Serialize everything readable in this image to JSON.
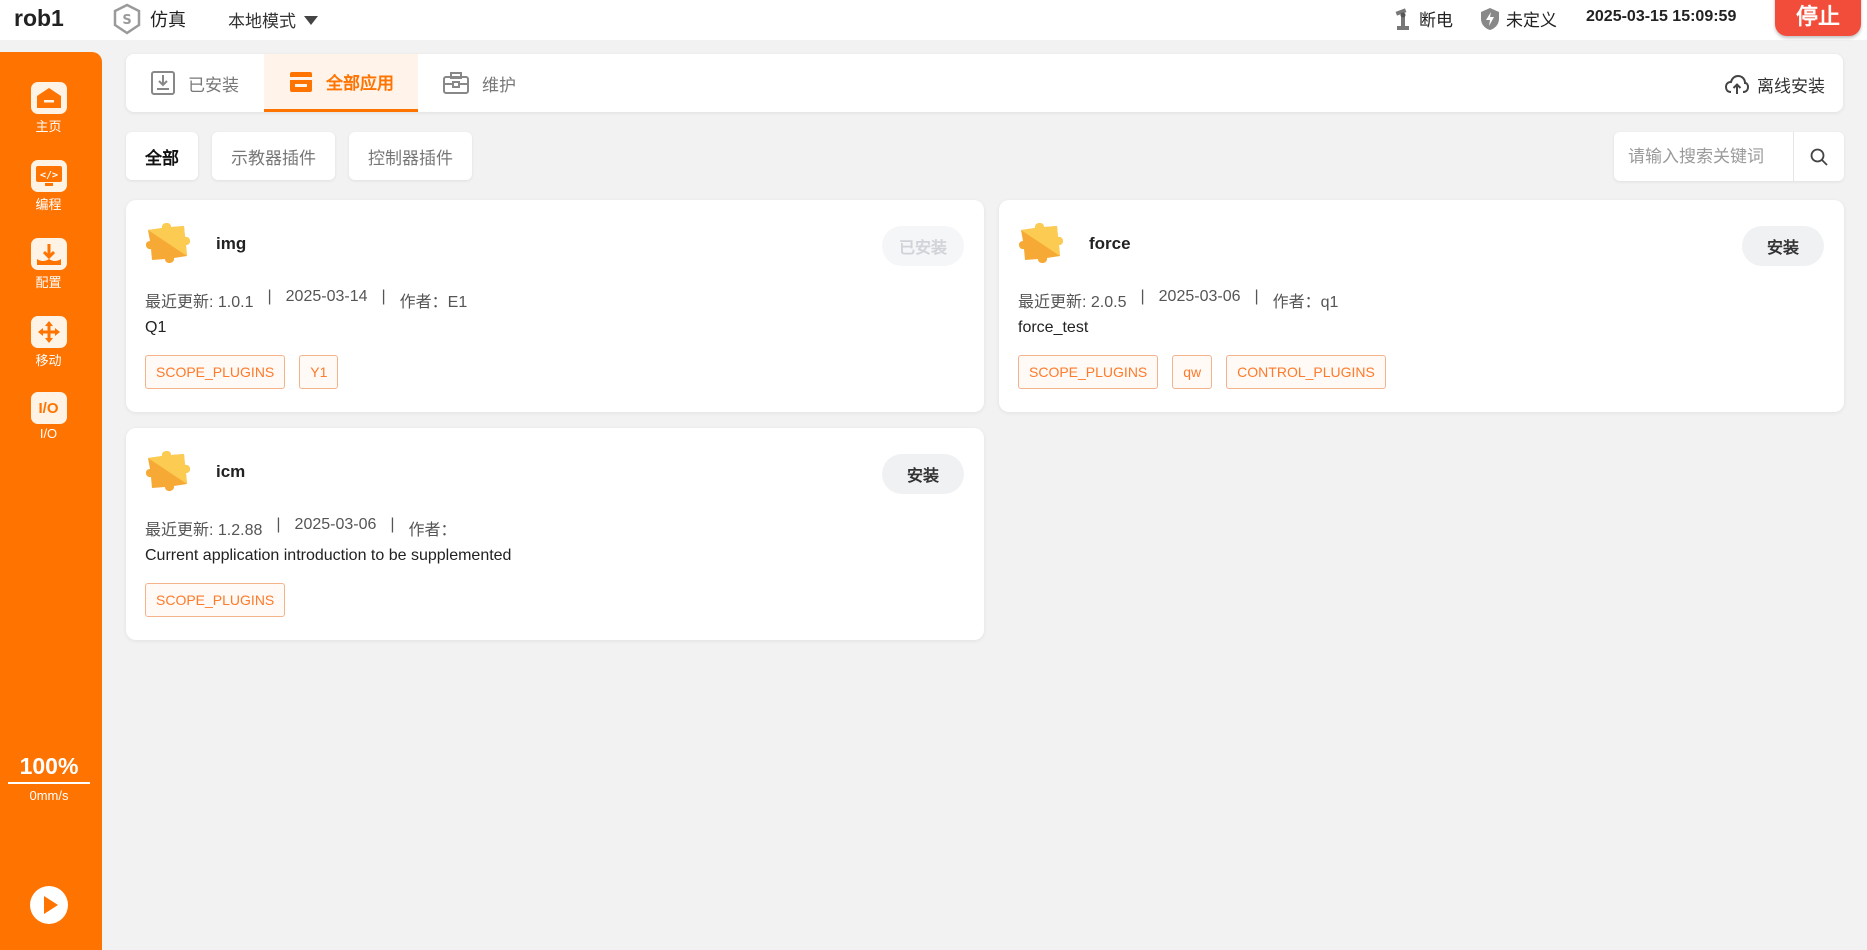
{
  "header": {
    "robot_name": "rob1",
    "sim_label": "仿真",
    "mode_label": "本地模式",
    "power_label": "断电",
    "undefined_label": "未定义",
    "datetime": "2025-03-15 15:09:59",
    "stop_label": "停止"
  },
  "sidebar": {
    "items": [
      {
        "label": "主页",
        "icon": "home-icon"
      },
      {
        "label": "编程",
        "icon": "code-icon"
      },
      {
        "label": "配置",
        "icon": "config-icon"
      },
      {
        "label": "移动",
        "icon": "move-icon"
      },
      {
        "label": "I/O",
        "icon": "io-icon",
        "icon_text": "I/O"
      }
    ],
    "speed_percent": "100%",
    "speed_mm": "0mm/s",
    "question_marks": [
      "?",
      "?",
      "?",
      "?"
    ]
  },
  "tabs": {
    "items": [
      {
        "label": "已安装",
        "icon": "installed-icon"
      },
      {
        "label": "全部应用",
        "icon": "store-icon",
        "active": true
      },
      {
        "label": "维护",
        "icon": "toolbox-icon"
      }
    ],
    "offline_install": "离线安装"
  },
  "filters": {
    "items": [
      "全部",
      "示教器插件",
      "控制器插件"
    ],
    "active": "全部",
    "search_placeholder": "请输入搜索关键词"
  },
  "apps": [
    {
      "name": "img",
      "action": "已安装",
      "action_disabled": true,
      "update_label": "最近更新: 1.0.1",
      "date": "2025-03-14",
      "author": "作者：E1",
      "description": "Q1",
      "tags": [
        "SCOPE_PLUGINS",
        "Y1"
      ]
    },
    {
      "name": "force",
      "action": "安装",
      "action_disabled": false,
      "update_label": "最近更新: 2.0.5",
      "date": "2025-03-06",
      "author": "作者：q1",
      "description": "force_test",
      "tags": [
        "SCOPE_PLUGINS",
        "qw",
        "CONTROL_PLUGINS"
      ]
    },
    {
      "name": "icm",
      "action": "安装",
      "action_disabled": false,
      "update_label": "最近更新: 1.2.88",
      "date": "2025-03-06",
      "author": "作者：",
      "description": "Current application introduction to be supplemented",
      "tags": [
        "SCOPE_PLUGINS"
      ]
    }
  ],
  "colors": {
    "accent": "#ff7300",
    "stop": "#f24d3a",
    "tag_text": "#ff7a2a"
  }
}
